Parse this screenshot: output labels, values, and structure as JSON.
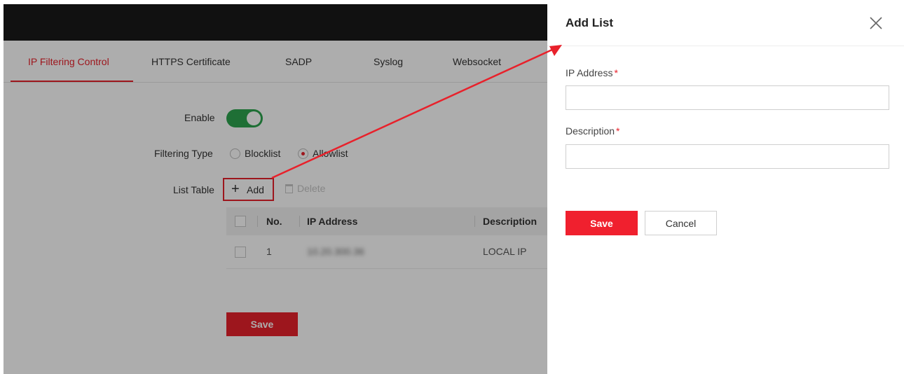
{
  "tabs": [
    {
      "label": "IP Filtering Control",
      "active": true
    },
    {
      "label": "HTTPS Certificate",
      "active": false
    },
    {
      "label": "SADP",
      "active": false
    },
    {
      "label": "Syslog",
      "active": false
    },
    {
      "label": "Websocket",
      "active": false
    }
  ],
  "form": {
    "enable_label": "Enable",
    "enable_on": true,
    "filtering_type_label": "Filtering Type",
    "filtering_options": [
      "Blocklist",
      "Allowlist"
    ],
    "filtering_selected": "Allowlist",
    "list_table_label": "List Table",
    "add_label": "Add",
    "delete_label": "Delete"
  },
  "table": {
    "columns": [
      "No.",
      "IP Address",
      "Description"
    ],
    "rows": [
      {
        "no": "1",
        "ip": "10.20.300.36",
        "description": "LOCAL IP"
      }
    ]
  },
  "page_save_label": "Save",
  "drawer": {
    "title": "Add List",
    "ip_label": "IP Address",
    "ip_value": "",
    "description_label": "Description",
    "description_value": "",
    "required_mark": "*",
    "save_label": "Save",
    "cancel_label": "Cancel"
  },
  "colors": {
    "accent": "#e8212b",
    "toggle_on": "#2da44e",
    "topbar": "#1a1a1a"
  },
  "icons": {
    "close": "close-icon",
    "add": "plus-icon",
    "delete": "trash-icon"
  }
}
